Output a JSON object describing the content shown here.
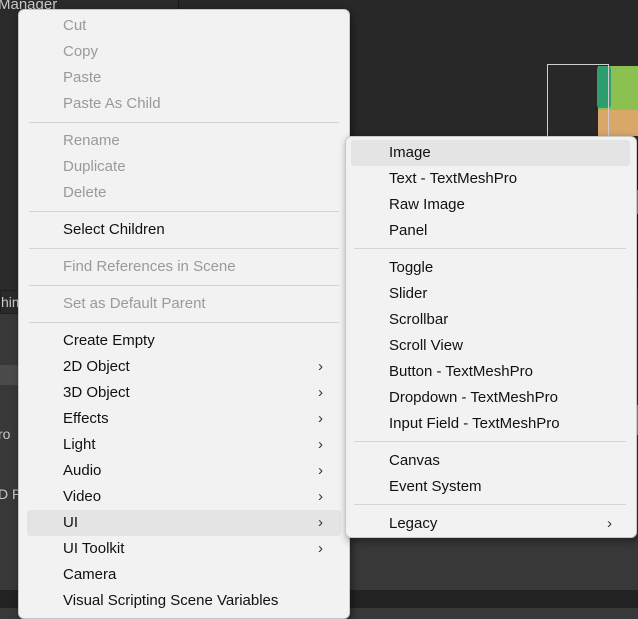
{
  "background": {
    "window_title_fragment": "Manager",
    "field_fragment": "him",
    "label_fragment_1": "ro",
    "label_fragment_2": "D P"
  },
  "context_menu": {
    "items": [
      {
        "label": "Cut",
        "enabled": false
      },
      {
        "label": "Copy",
        "enabled": false
      },
      {
        "label": "Paste",
        "enabled": false
      },
      {
        "label": "Paste As Child",
        "enabled": false
      },
      {
        "label": "Rename",
        "enabled": false
      },
      {
        "label": "Duplicate",
        "enabled": false
      },
      {
        "label": "Delete",
        "enabled": false
      },
      {
        "label": "Select Children",
        "enabled": true
      },
      {
        "label": "Find References in Scene",
        "enabled": false
      },
      {
        "label": "Set as Default Parent",
        "enabled": false
      },
      {
        "label": "Create Empty",
        "enabled": true
      },
      {
        "label": "2D Object",
        "enabled": true,
        "submenu": true
      },
      {
        "label": "3D Object",
        "enabled": true,
        "submenu": true
      },
      {
        "label": "Effects",
        "enabled": true,
        "submenu": true
      },
      {
        "label": "Light",
        "enabled": true,
        "submenu": true
      },
      {
        "label": "Audio",
        "enabled": true,
        "submenu": true
      },
      {
        "label": "Video",
        "enabled": true,
        "submenu": true
      },
      {
        "label": "UI",
        "enabled": true,
        "submenu": true,
        "highlighted": true
      },
      {
        "label": "UI Toolkit",
        "enabled": true,
        "submenu": true
      },
      {
        "label": "Camera",
        "enabled": true
      },
      {
        "label": "Visual Scripting Scene Variables",
        "enabled": true
      }
    ],
    "arrow_glyph": "›"
  },
  "ui_submenu": {
    "items": [
      {
        "label": "Image",
        "highlighted": true
      },
      {
        "label": "Text - TextMeshPro"
      },
      {
        "label": "Raw Image"
      },
      {
        "label": "Panel"
      },
      {
        "label": "Toggle"
      },
      {
        "label": "Slider"
      },
      {
        "label": "Scrollbar"
      },
      {
        "label": "Scroll View"
      },
      {
        "label": "Button - TextMeshPro"
      },
      {
        "label": "Dropdown - TextMeshPro"
      },
      {
        "label": "Input Field - TextMeshPro"
      },
      {
        "label": "Canvas"
      },
      {
        "label": "Event System"
      },
      {
        "label": "Legacy",
        "submenu": true
      }
    ]
  },
  "colors": {
    "menu_bg": "#f2f2f2",
    "highlight": "#e4e4e4",
    "disabled_text": "#9a9a9a",
    "editor_dark": "#282828"
  }
}
